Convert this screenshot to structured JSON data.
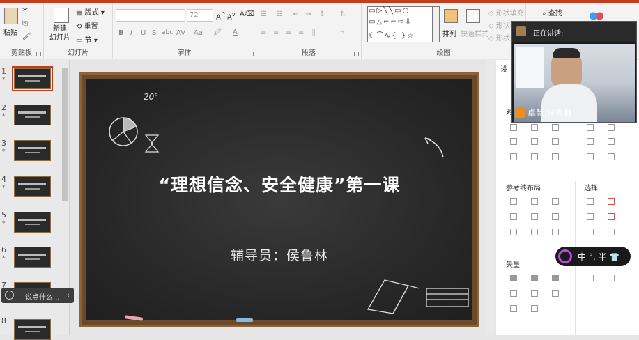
{
  "ribbon": {
    "clipboard": {
      "paste_label": "粘贴",
      "group_label": "剪贴板"
    },
    "slides": {
      "new_slide_label": "新建\n幻灯片",
      "layout_label": "版式",
      "reset_label": "重置",
      "section_label": "节",
      "group_label": "幻灯片"
    },
    "font": {
      "font_size_value": "72",
      "bold": "B",
      "italic": "I",
      "underline": "U",
      "strike": "S",
      "shadow": "abc",
      "spacing": "AV",
      "case": "Aa",
      "group_label": "字体"
    },
    "paragraph": {
      "group_label": "段落"
    },
    "drawing": {
      "arrange_label": "排列",
      "quick_styles_label": "快速样式",
      "shape_fill_label": "形状填充",
      "shape_outline_label": "形状轮廓",
      "shape_effects_label": "形状效果",
      "group_label": "绘图"
    },
    "editing": {
      "find_label": "查找"
    }
  },
  "thumbnails": [
    {
      "num": "1",
      "selected": true
    },
    {
      "num": "2",
      "selected": false
    },
    {
      "num": "3",
      "selected": false
    },
    {
      "num": "4",
      "selected": false
    },
    {
      "num": "5",
      "selected": false
    },
    {
      "num": "6",
      "selected": false
    },
    {
      "num": "7",
      "selected": false
    },
    {
      "num": "8",
      "selected": false
    }
  ],
  "slide": {
    "title": "“理想信念、安全健康”第一课",
    "subtitle": "辅导员：侯鲁林",
    "chalk_note": "20°"
  },
  "format_pane": {
    "title": "设",
    "align_heading": "对",
    "guides_layout_label": "参考线布局",
    "select_label": "选择",
    "vector_label": "矢量"
  },
  "meeting": {
    "speaking_label": "正在讲话:",
    "speaker_name": "卓慧|侯鲁林"
  },
  "ime": {
    "text": "中 °, 半 👕"
  },
  "chat": {
    "placeholder": "说点什么..."
  },
  "colors": {
    "accent": "#c43e1c",
    "board_frame": "#8b6338",
    "slate": "#2a2a2a"
  }
}
